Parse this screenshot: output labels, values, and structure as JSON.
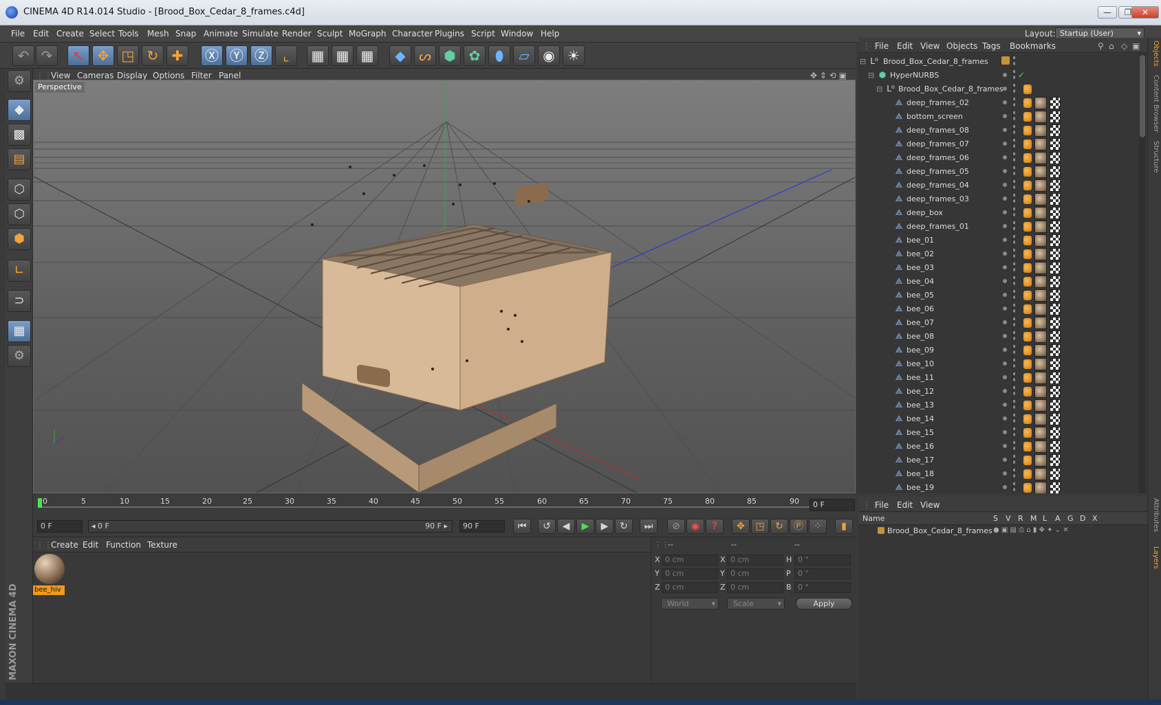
{
  "window": {
    "title": "CINEMA 4D R14.014 Studio - [Brood_Box_Cedar_8_frames.c4d]",
    "minimize": "—",
    "maximize": "❐",
    "close": "✕"
  },
  "menubar": {
    "items": [
      "File",
      "Edit",
      "Create",
      "Select",
      "Tools",
      "Mesh",
      "Snap",
      "Animate",
      "Simulate",
      "Render",
      "Sculpt",
      "MoGraph",
      "Character",
      "Plugins",
      "Script",
      "Window",
      "Help"
    ],
    "layout_label": "Layout:",
    "layout_value": "Startup (User)"
  },
  "viewport": {
    "menu": [
      "View",
      "Cameras",
      "Display",
      "Options",
      "Filter",
      "Panel"
    ],
    "label": "Perspective"
  },
  "timeline": {
    "ticks": [
      "0",
      "5",
      "10",
      "15",
      "20",
      "25",
      "30",
      "35",
      "40",
      "45",
      "50",
      "55",
      "60",
      "65",
      "70",
      "75",
      "80",
      "85",
      "90"
    ],
    "current_frame": "0 F",
    "start_field": "0 F",
    "range_start": "◂ 0 F",
    "range_end": "90 F ▸",
    "end_field": "90 F"
  },
  "materials": {
    "menu": [
      "Create",
      "Edit",
      "Function",
      "Texture"
    ],
    "items": [
      {
        "name": "bee_hiv"
      }
    ]
  },
  "coordinates": {
    "headers": [
      "--",
      "--",
      "--"
    ],
    "rows": [
      {
        "pos_label": "X",
        "pos_value": "0 cm",
        "size_label": "X",
        "size_value": "0 cm",
        "rot_label": "H",
        "rot_value": "0 °"
      },
      {
        "pos_label": "Y",
        "pos_value": "0 cm",
        "size_label": "Y",
        "size_value": "0 cm",
        "rot_label": "P",
        "rot_value": "0 °"
      },
      {
        "pos_label": "Z",
        "pos_value": "0 cm",
        "size_label": "Z",
        "size_value": "0 cm",
        "rot_label": "B",
        "rot_value": "0 °"
      }
    ],
    "mode1": "World",
    "mode2": "Scale",
    "apply": "Apply"
  },
  "object_manager": {
    "menu": [
      "File",
      "Edit",
      "View",
      "Objects",
      "Tags",
      "Bookmarks"
    ],
    "root": "Brood_Box_Cedar_8_frames",
    "hypernurbs": "HyperNURBS",
    "group": "Brood_Box_Cedar_8_frames",
    "children": [
      "deep_frames_02",
      "bottom_screen",
      "deep_frames_08",
      "deep_frames_07",
      "deep_frames_06",
      "deep_frames_05",
      "deep_frames_04",
      "deep_frames_03",
      "deep_box",
      "deep_frames_01",
      "bee_01",
      "bee_02",
      "bee_03",
      "bee_04",
      "bee_05",
      "bee_06",
      "bee_07",
      "bee_08",
      "bee_09",
      "bee_10",
      "bee_11",
      "bee_12",
      "bee_13",
      "bee_14",
      "bee_15",
      "bee_16",
      "bee_17",
      "bee_18",
      "bee_19"
    ]
  },
  "layer_manager": {
    "menu": [
      "File",
      "Edit",
      "View"
    ],
    "columns": [
      "Name",
      "S",
      "V",
      "R",
      "M",
      "L",
      "A",
      "G",
      "D",
      "X"
    ],
    "layer_name": "Brood_Box_Cedar_8_frames"
  },
  "side_tabs": [
    "Objects",
    "Content Browser",
    "Structure",
    "Attributes",
    "Layers"
  ],
  "branding": "MAXON CINEMA 4D",
  "colors": {
    "accent": "#f2a23a",
    "selection": "#7a9ec9",
    "background": "#3a3a3a"
  }
}
